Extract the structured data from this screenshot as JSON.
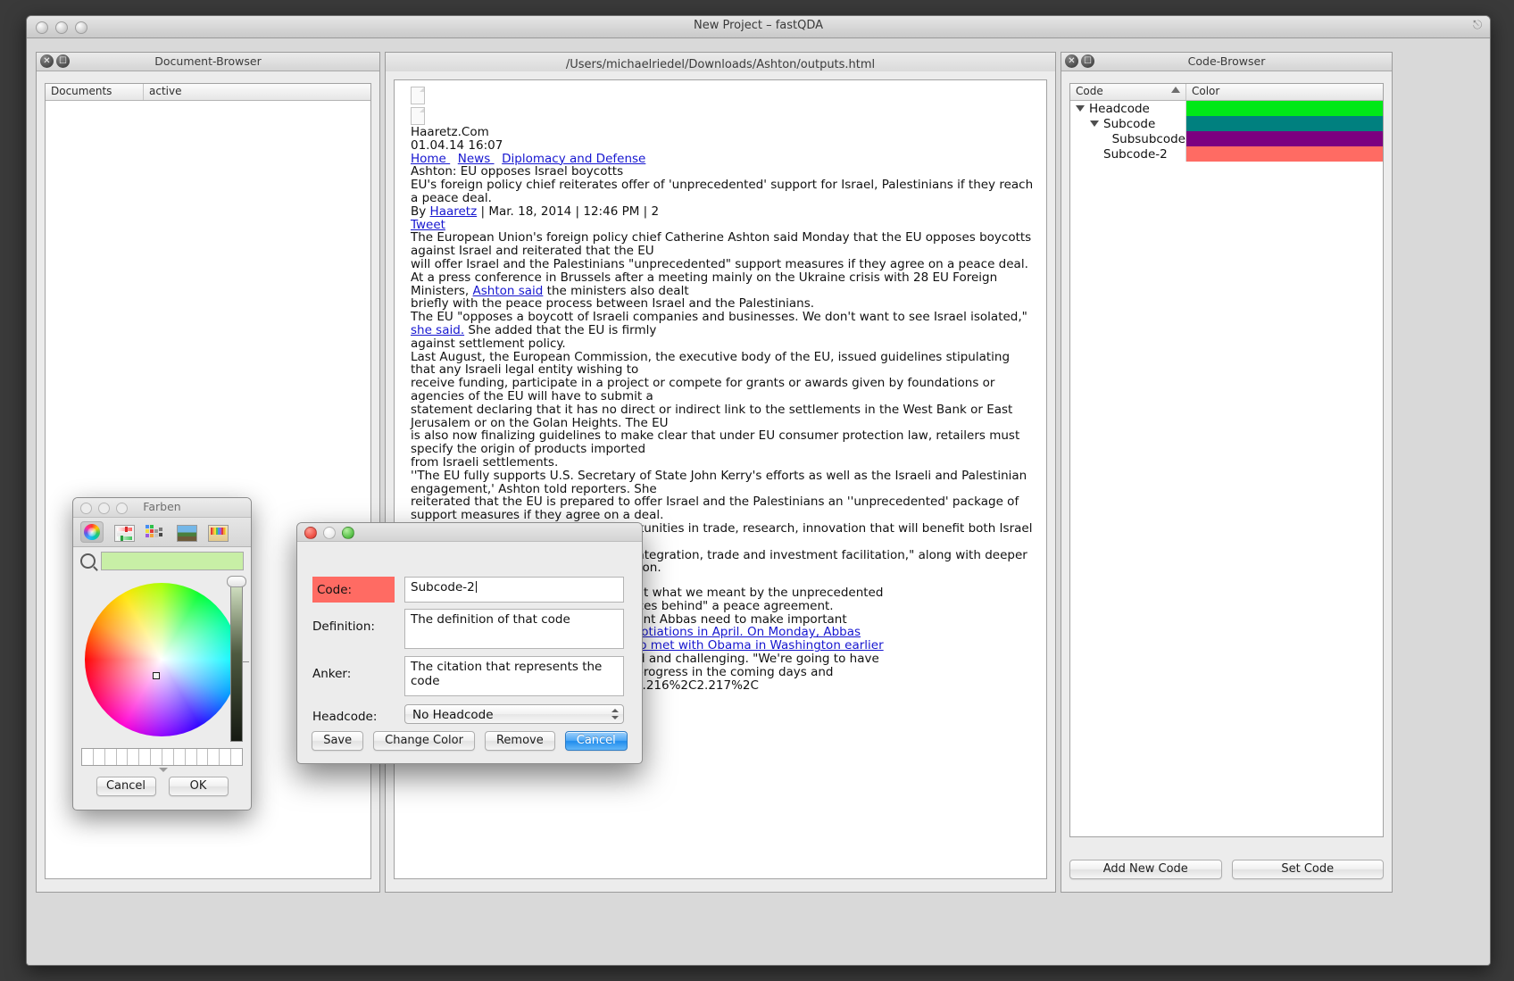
{
  "window": {
    "title": "New Project – fastQDA"
  },
  "document_browser": {
    "title": "Document-Browser",
    "columns": [
      "Documents",
      "active"
    ],
    "rows": []
  },
  "document_view": {
    "title": "/Users/michaelriedel/Downloads/Ashton/outputs.html",
    "source": "Haaretz.Com",
    "fetched": "01.04.14 16:07",
    "breadcrumb": [
      "Home ",
      "News ",
      "Diplomacy and Defense"
    ],
    "headline": "Ashton: EU opposes Israel boycotts",
    "subheadline": "EU's foreign policy chief reiterates offer of 'unprecedented' support for Israel, Palestinians if they reach a peace deal.",
    "byline_prefix": "By ",
    "byline_author": "Haaretz",
    "byline_rest": " | Mar. 18, 2014 | 12:46 PM |   2",
    "tweet": "Tweet",
    "body_lines": [
      "The European Union's foreign policy chief Catherine Ashton said Monday that the EU opposes boycotts against Israel and reiterated that the EU",
      "will offer Israel and the Palestinians \"unprecedented\" support measures if they agree on a peace deal.",
      "At a press conference in Brussels after a meeting mainly on the Ukraine crisis with 28 EU Foreign Ministers, |LINK:Ashton said| the ministers also dealt",
      "briefly with the peace process between Israel and the Palestinians.",
      "The EU \"opposes a boycott of Israeli companies and businesses. We don't want to see Israel isolated,\"|LINK: she said.| She added that the EU is firmly",
      "against settlement policy.",
      "Last August, the European Commission, the executive body of the EU, issued guidelines stipulating that any Israeli legal entity wishing to",
      "receive funding, participate in a project or compete for grants or awards given by foundations or agencies of the EU will have to submit a",
      "statement declaring that it has no direct or indirect link to the settlements in the West Bank or East Jerusalem or on the Golan Heights. The EU",
      "is also now finalizing guidelines to make clear that under EU consumer protection law, retailers must specify the origin of products imported",
      "from Israeli settlements.",
      "''The EU fully supports U.S. Secretary of State John Kerry's efforts as well as the Israeli and Palestinian engagement,'  Ashton told reporters. She",
      "reiterated that the EU is prepared to offer Israel and the Palestinians an ''unprecedented'  package of support measures if they agree on a deal.",
      "The package will \"provide huge opportunities in trade, research, innovation that will benefit both Israel and the Palestinians.\"",
      "\"We want to see progressive market integration, trade and investment facilitation,\" along with deeper ties in research and security cooperation."
    ],
    "tail_paragraphs": [
      "clear that we needed to start to set out what we meant by the unprecedented",
      "he EU \"will put our energy and resources behind\" a peace agreement.",
      "yahu and Palestinian Authority President Abbas need to make important",
      "|LINK:the end of a nine-month period of negotiations in April. On Monday, Abbas",
      "|LINK:uss the peace process. Netanyahu also met with Obama in Washington earlier",
      "ching a peace deal would be very hard and challenging. \"We're going to have",
      "ove it forward and I hope we will see progress in the coming days and",
      "ge/1.580447?trailingPath=2.169%2C2.216%2C2.217%2C"
    ]
  },
  "code_browser": {
    "title": "Code-Browser",
    "columns": [
      "Code",
      "Color"
    ],
    "rows": [
      {
        "label": "Headcode",
        "indent": 0,
        "expanded": true,
        "twisty": true,
        "color": "#00e817"
      },
      {
        "label": "Subcode",
        "indent": 1,
        "expanded": true,
        "twisty": true,
        "color": "#00807f"
      },
      {
        "label": "Subsubcode",
        "indent": 2,
        "expanded": false,
        "twisty": false,
        "color": "#7c0080"
      },
      {
        "label": "Subcode-2",
        "indent": 1,
        "expanded": false,
        "twisty": false,
        "color": "#ff6b63"
      }
    ],
    "buttons": {
      "add": "Add New Code",
      "set": "Set Code"
    }
  },
  "color_picker": {
    "title": "Farben",
    "toolbar_icons": [
      "color-wheel-icon",
      "color-sliders-icon",
      "color-palettes-icon",
      "image-palettes-icon",
      "crayons-icon"
    ],
    "search_placeholder": "",
    "selected_swatch_color": "#c8efa6",
    "buttons": {
      "cancel": "Cancel",
      "ok": "OK"
    },
    "swatch_count": 14
  },
  "code_dialog": {
    "fields": {
      "code_label": "Code:",
      "code_value": "Subcode-2",
      "code_label_color": "#ff6b63",
      "definition_label": "Definition:",
      "definition_value": "The definition of that code",
      "anker_label": "Anker:",
      "anker_value": "The citation that represents the code",
      "headcode_label": "Headcode:",
      "headcode_value": "No Headcode"
    },
    "buttons": {
      "save": "Save",
      "change_color": "Change Color",
      "remove": "Remove",
      "cancel": "Cancel"
    }
  }
}
